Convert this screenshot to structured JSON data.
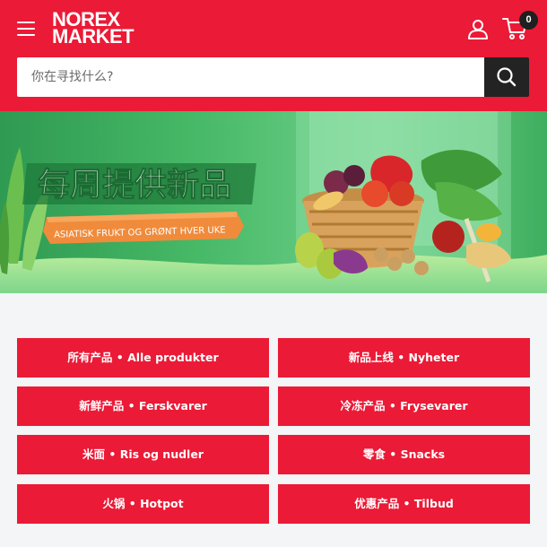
{
  "header": {
    "logo_line1": "NOREX",
    "logo_line2": "MARKET",
    "cart_count": "0",
    "icons": {
      "menu": "hamburger-menu-icon",
      "account": "user-icon",
      "cart": "cart-icon",
      "search": "search-icon"
    },
    "colors": {
      "brand": "#eb1a36",
      "dark": "#232323"
    }
  },
  "search": {
    "placeholder": "你在寻找什么?",
    "value": ""
  },
  "banner": {
    "headline": "每周提供新品",
    "ribbon": "ASIATISK FRUKT OG GRØNT HVER UKE"
  },
  "categories": [
    {
      "label": "所有产品 • Alle produkter"
    },
    {
      "label": "新品上线 • Nyheter"
    },
    {
      "label": "新鲜产品 • Ferskvarer"
    },
    {
      "label": "冷冻产品 • Frysevarer"
    },
    {
      "label": "米面 • Ris og nudler"
    },
    {
      "label": "零食 • Snacks"
    },
    {
      "label": "火锅 • Hotpot"
    },
    {
      "label": "优惠产品 • Tilbud"
    }
  ]
}
